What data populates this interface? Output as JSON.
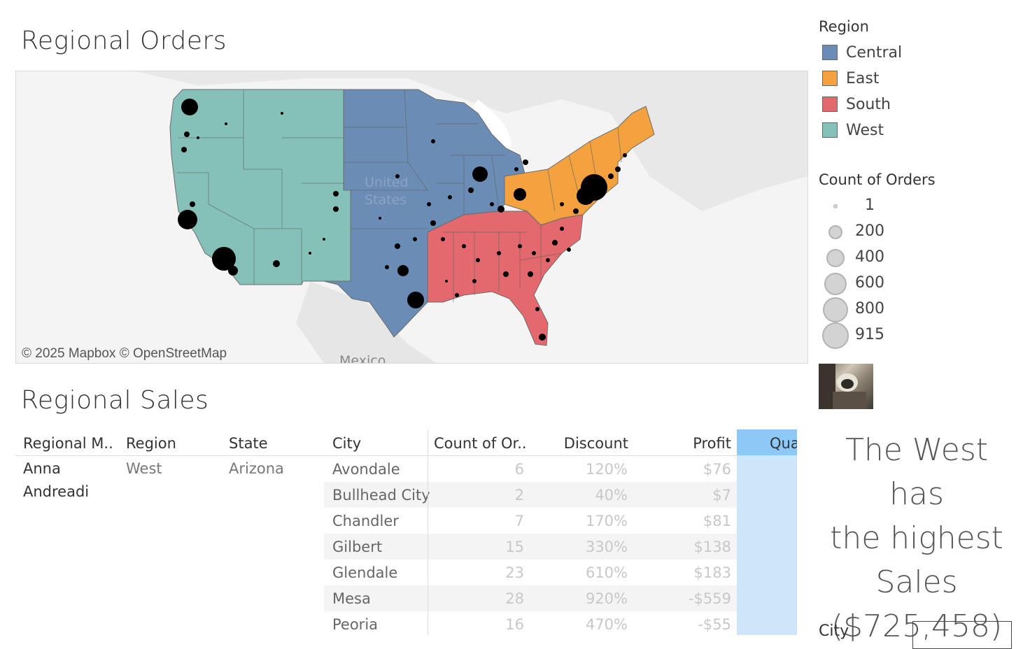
{
  "map_section": {
    "title": "Regional Orders",
    "credit": "© 2025 Mapbox  © OpenStreetMap",
    "map_labels": {
      "country": "United States",
      "neighbor": "Mexico"
    }
  },
  "legend": {
    "region_title": "Region",
    "regions": [
      {
        "label": "Central",
        "color": "#6b8db5"
      },
      {
        "label": "East",
        "color": "#f4a13f"
      },
      {
        "label": "South",
        "color": "#e4696f"
      },
      {
        "label": "West",
        "color": "#86c1b9"
      }
    ],
    "count_title": "Count of Orders",
    "sizes": [
      "1",
      "200",
      "400",
      "600",
      "800",
      "915"
    ]
  },
  "sales_section": {
    "title": "Regional Sales",
    "columns": [
      "Regional M..",
      "Region",
      "State",
      "City",
      "Count of Or..",
      "Discount",
      "Profit",
      "Qua"
    ],
    "manager": "Anna Andreadi",
    "region": "West",
    "state": "Arizona",
    "rows": [
      {
        "city": "Avondale",
        "count": "6",
        "discount": "120%",
        "profit": "$76"
      },
      {
        "city": "Bullhead City",
        "count": "2",
        "discount": "40%",
        "profit": "$7"
      },
      {
        "city": "Chandler",
        "count": "7",
        "discount": "170%",
        "profit": "$81"
      },
      {
        "city": "Gilbert",
        "count": "15",
        "discount": "330%",
        "profit": "$138"
      },
      {
        "city": "Glendale",
        "count": "23",
        "discount": "610%",
        "profit": "$183"
      },
      {
        "city": "Mesa",
        "count": "28",
        "discount": "920%",
        "profit": "-$559"
      },
      {
        "city": "Peoria",
        "count": "16",
        "discount": "470%",
        "profit": "-$55"
      }
    ]
  },
  "insight": {
    "headline_lines": [
      "The West has",
      "the highest",
      "Sales",
      "($725,458)"
    ]
  },
  "filter": {
    "label": "City"
  }
}
